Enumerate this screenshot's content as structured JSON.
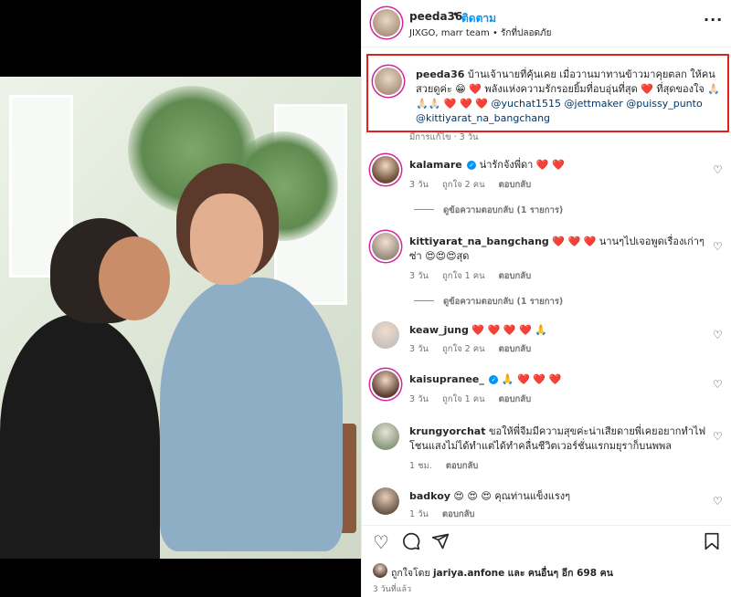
{
  "header": {
    "username": "peeda36",
    "separator": "•",
    "follow_label": "ติดตาม",
    "subtitle": "JIXGO, marr team • รักที่ปลอดภัย",
    "more_icon": "more-icon"
  },
  "caption": {
    "username": "peeda36",
    "text": "บ้านเจ้านายที่คุ้นเคย เมื่อวานมาทานข้าวมาคุยตลก ให้คนสวยดูค่ะ 😁 ❤️ พลังแห่งความรักรอยยิ้มที่อบอุ่นที่สุด ❤️ ที่สุดของใจ 🙏🏻🙏🏻🙏🏻 ❤️ ❤️ ❤️",
    "mentions": [
      "@yuchat1515",
      "@jettmaker",
      "@puissy_punto",
      "@kittiyarat_na_bangchang"
    ],
    "meta": "มีการแก้ไข · 3 วัน"
  },
  "comments": [
    {
      "username": "kalamare",
      "verified": true,
      "text": "น่ารักจังพี่ดา ❤️ ❤️",
      "time": "3 วัน",
      "likes": "ถูกใจ 2 คน",
      "reply_label": "ตอบกลับ",
      "view_replies": "ดูข้อความตอบกลับ (1 รายการ)"
    },
    {
      "username": "kittiyarat_na_bangchang",
      "verified": false,
      "text": "❤️ ❤️ ❤️ นานๆไปเจอพูดเรื่องเก่าๆซ่า 😍😍😍สุด",
      "time": "3 วัน",
      "likes": "ถูกใจ 1 คน",
      "reply_label": "ตอบกลับ",
      "view_replies": "ดูข้อความตอบกลับ (1 รายการ)"
    },
    {
      "username": "keaw_jung",
      "verified": false,
      "text": "❤️ ❤️ ❤️ ❤️ 🙏",
      "time": "3 วัน",
      "likes": "ถูกใจ 2 คน",
      "reply_label": "ตอบกลับ"
    },
    {
      "username": "kaisupranee_",
      "verified": true,
      "text": "🙏 ❤️ ❤️ ❤️",
      "time": "3 วัน",
      "likes": "ถูกใจ 1 คน",
      "reply_label": "ตอบกลับ"
    },
    {
      "username": "krungyorchat",
      "verified": false,
      "text": "ขอให้พี่จีมมีความสุขค่ะน่าเสียดายพี่เคยอยากทำไฟโชนแสงไม่ได้ทำแต่ได้ทำคลื่นชีวิตเวอร์ชั่นแรกมยุราก็บนพพล",
      "time": "1 ชม.",
      "reply_label": "ตอบกลับ"
    },
    {
      "username": "badkoy",
      "verified": false,
      "text": "😍 😍 😍 คุณท่านแข็งแรงๆ",
      "time": "1 วัน",
      "reply_label": "ตอบกลับ"
    }
  ],
  "actions": {
    "like_icon": "heart-icon",
    "comment_icon": "comment-icon",
    "share_icon": "share-icon",
    "save_icon": "bookmark-icon",
    "likes_prefix": "ถูกใจโดย",
    "likes_user": "jariya.anfone",
    "likes_middle": "และ",
    "likes_others": "คนอื่นๆ อีก 698 คน",
    "post_time": "3 วันที่แล้ว"
  },
  "colors": {
    "accent": "#0095f6",
    "highlight_box": "#e32020",
    "muted": "#737373"
  }
}
